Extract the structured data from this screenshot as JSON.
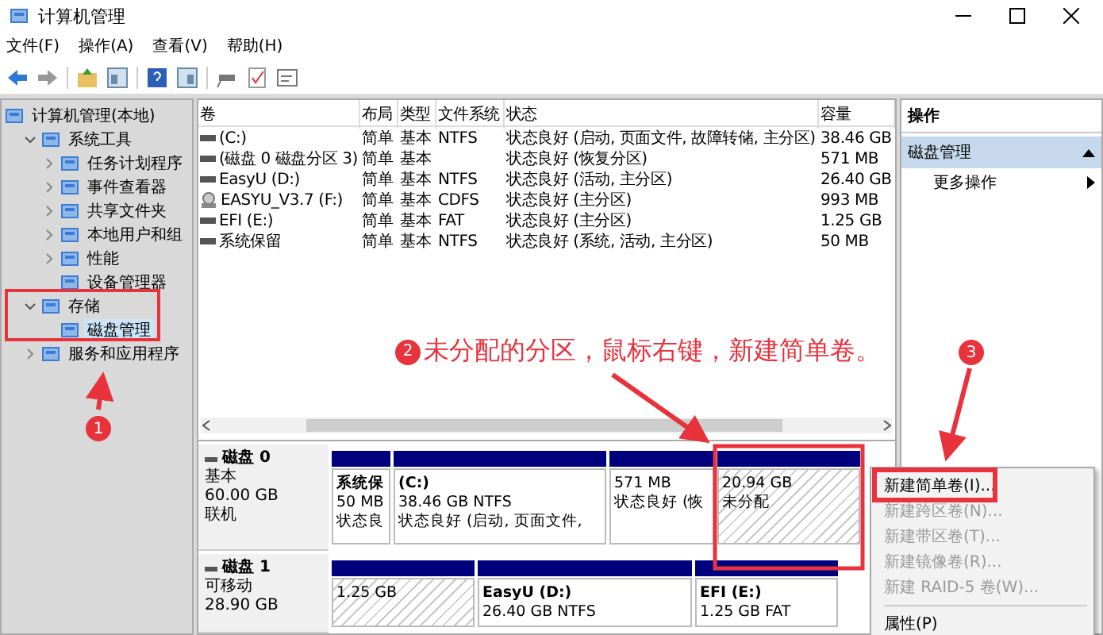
{
  "window": {
    "title": "计算机管理"
  },
  "menu": [
    "文件(F)",
    "操作(A)",
    "查看(V)",
    "帮助(H)"
  ],
  "tree": [
    {
      "label": "计算机管理(本地)",
      "kind": "root",
      "selected": false,
      "children": [
        {
          "label": "系统工具",
          "kind": "branch",
          "expanded": true,
          "selected": false,
          "children": [
            {
              "label": "任务计划程序",
              "kind": "branch",
              "expanded": false,
              "selected": false
            },
            {
              "label": "事件查看器",
              "kind": "branch",
              "expanded": false,
              "selected": false
            },
            {
              "label": "共享文件夹",
              "kind": "branch",
              "expanded": false,
              "selected": false
            },
            {
              "label": "本地用户和组",
              "kind": "branch",
              "expanded": false,
              "selected": false
            },
            {
              "label": "性能",
              "kind": "branch",
              "expanded": false,
              "selected": false
            },
            {
              "label": "设备管理器",
              "kind": "leaf",
              "selected": false
            }
          ]
        },
        {
          "label": "存储",
          "kind": "branch",
          "expanded": true,
          "selected": false,
          "children": [
            {
              "label": "磁盘管理",
              "kind": "leaf",
              "selected": true
            }
          ]
        },
        {
          "label": "服务和应用程序",
          "kind": "branch",
          "expanded": false,
          "selected": false
        }
      ]
    }
  ],
  "volumes": {
    "columns": [
      "卷",
      "布局",
      "类型",
      "文件系统",
      "状态",
      "容量"
    ],
    "rows": [
      {
        "kind": "disk",
        "cells": [
          "(C:)",
          "简单",
          "基本",
          "NTFS",
          "状态良好 (启动, 页面文件, 故障转储, 主分区)",
          "38.46 GB"
        ]
      },
      {
        "kind": "disk",
        "cells": [
          "(磁盘 0 磁盘分区 3)",
          "简单",
          "基本",
          "",
          "状态良好 (恢复分区)",
          "571 MB"
        ]
      },
      {
        "kind": "disk",
        "cells": [
          "EasyU (D:)",
          "简单",
          "基本",
          "NTFS",
          "状态良好 (活动, 主分区)",
          "26.40 GB"
        ]
      },
      {
        "kind": "cdrom",
        "cells": [
          "EASYU_V3.7 (F:)",
          "简单",
          "基本",
          "CDFS",
          "状态良好 (主分区)",
          "993 MB"
        ]
      },
      {
        "kind": "disk",
        "cells": [
          "EFI (E:)",
          "简单",
          "基本",
          "FAT",
          "状态良好 (主分区)",
          "1.25 GB"
        ]
      },
      {
        "kind": "disk",
        "cells": [
          "系统保留",
          "简单",
          "基本",
          "NTFS",
          "状态良好 (系统, 活动, 主分区)",
          "50 MB"
        ]
      }
    ]
  },
  "disks": [
    {
      "name": "磁盘 0",
      "type": "基本",
      "size": "60.00 GB",
      "status": "联机",
      "partitions": [
        {
          "kind": "primary",
          "name": "系统保",
          "size": "50 MB",
          "status": "状态良"
        },
        {
          "kind": "primary",
          "name": "(C:)",
          "size": "38.46 GB NTFS",
          "status": "状态良好 (启动, 页面文件,"
        },
        {
          "kind": "primary",
          "size": "571 MB",
          "status": "状态良好 (恢"
        },
        {
          "kind": "unallocated",
          "size": "20.94 GB",
          "status": "未分配"
        }
      ]
    },
    {
      "name": "磁盘 1",
      "type": "可移动",
      "size": "28.90 GB",
      "partitions": [
        {
          "kind": "unallocated",
          "size": "1.25 GB"
        },
        {
          "kind": "primary",
          "name": "EasyU (D:)",
          "size": "26.40 GB NTFS"
        },
        {
          "kind": "primary",
          "name": "EFI (E:)",
          "size": "1.25 GB FAT"
        }
      ]
    }
  ],
  "actions": {
    "title": "操作",
    "sections": [
      {
        "label": "磁盘管理",
        "expanded": true,
        "items": [
          "更多操作"
        ]
      }
    ]
  },
  "context_menu": [
    {
      "kind": "item",
      "label": "新建简单卷(I)...",
      "disabled": false
    },
    {
      "kind": "item",
      "label": "新建跨区卷(N)...",
      "disabled": true
    },
    {
      "kind": "item",
      "label": "新建带区卷(T)...",
      "disabled": true
    },
    {
      "kind": "item",
      "label": "新建镜像卷(R)...",
      "disabled": true
    },
    {
      "kind": "item",
      "label": "新建 RAID-5 卷(W)...",
      "disabled": true
    },
    {
      "kind": "separator"
    },
    {
      "kind": "item",
      "label": "属性(P)",
      "disabled": false
    }
  ],
  "annotation": {
    "steps": [
      "1",
      "2",
      "3"
    ],
    "text": "未分配的分区，鼠标右键，新建简单卷。"
  }
}
